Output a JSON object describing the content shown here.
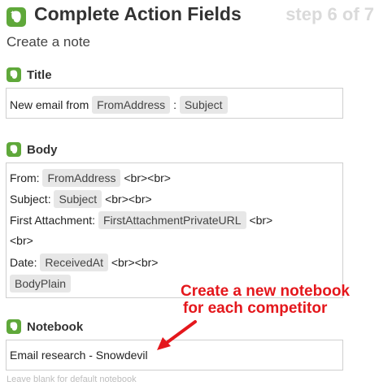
{
  "header": {
    "title": "Complete Action Fields",
    "step": "step 6 of 7",
    "subtitle": "Create a note"
  },
  "fields": {
    "title": {
      "label": "Title",
      "prefix": "New email from",
      "token1": "FromAddress",
      "separator": ":",
      "token2": "Subject"
    },
    "body": {
      "label": "Body",
      "from_label": "From:",
      "from_token": "FromAddress",
      "br": "<br><br>",
      "subject_label": "Subject:",
      "subject_token": "Subject",
      "attach_label": "First Attachment:",
      "attach_token": "FirstAttachmentPrivateURL",
      "br_single": "<br>",
      "br_single2": "<br>",
      "date_label": "Date:",
      "date_token": "ReceivedAt",
      "body_token": "BodyPlain"
    },
    "notebook": {
      "label": "Notebook",
      "value": "Email research - Snowdevil",
      "hint": "Leave blank for default notebook"
    }
  },
  "annotation": {
    "line1": "Create a new notebook",
    "line2": "for each competitor",
    "color": "#e4171c"
  },
  "colors": {
    "evernote_green": "#5fa83a"
  },
  "icons": {
    "header": "evernote-icon",
    "section": "evernote-icon"
  }
}
